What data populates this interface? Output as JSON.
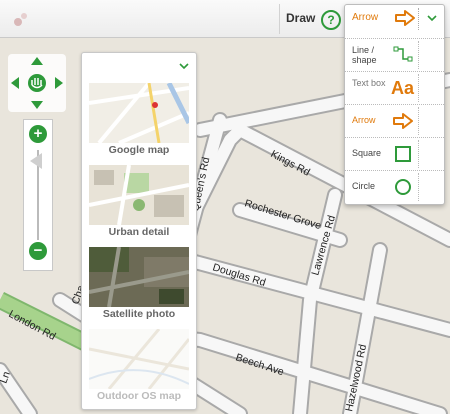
{
  "toolbar": {
    "draw_label": "Draw",
    "help_symbol": "?"
  },
  "draw_menu": {
    "current_label": "Arrow",
    "items": [
      {
        "label": "Line / shape",
        "icon": "line-shape-icon"
      },
      {
        "label": "Text box",
        "icon": "text-box-icon",
        "icon_text": "Aa"
      },
      {
        "label": "Arrow",
        "icon": "arrow-icon"
      },
      {
        "label": "Square",
        "icon": "square-icon"
      },
      {
        "label": "Circle",
        "icon": "circle-icon"
      }
    ],
    "accent_orange": "#e07a0c",
    "accent_green": "#2e9a3a"
  },
  "zoom": {
    "in_symbol": "+",
    "out_symbol": "−"
  },
  "layers": [
    {
      "name": "Google map"
    },
    {
      "name": "Urban detail"
    },
    {
      "name": "Satellite photo"
    },
    {
      "name": "Outdoor OS map"
    }
  ],
  "map": {
    "roads": [
      "Kings Rd",
      "Queen's Rd",
      "Rochester Grove",
      "Lawrence Rd",
      "Douglas Rd",
      "London Rd",
      "Beech Ave",
      "Hazelwood Rd",
      "Ln",
      "Cha"
    ]
  }
}
